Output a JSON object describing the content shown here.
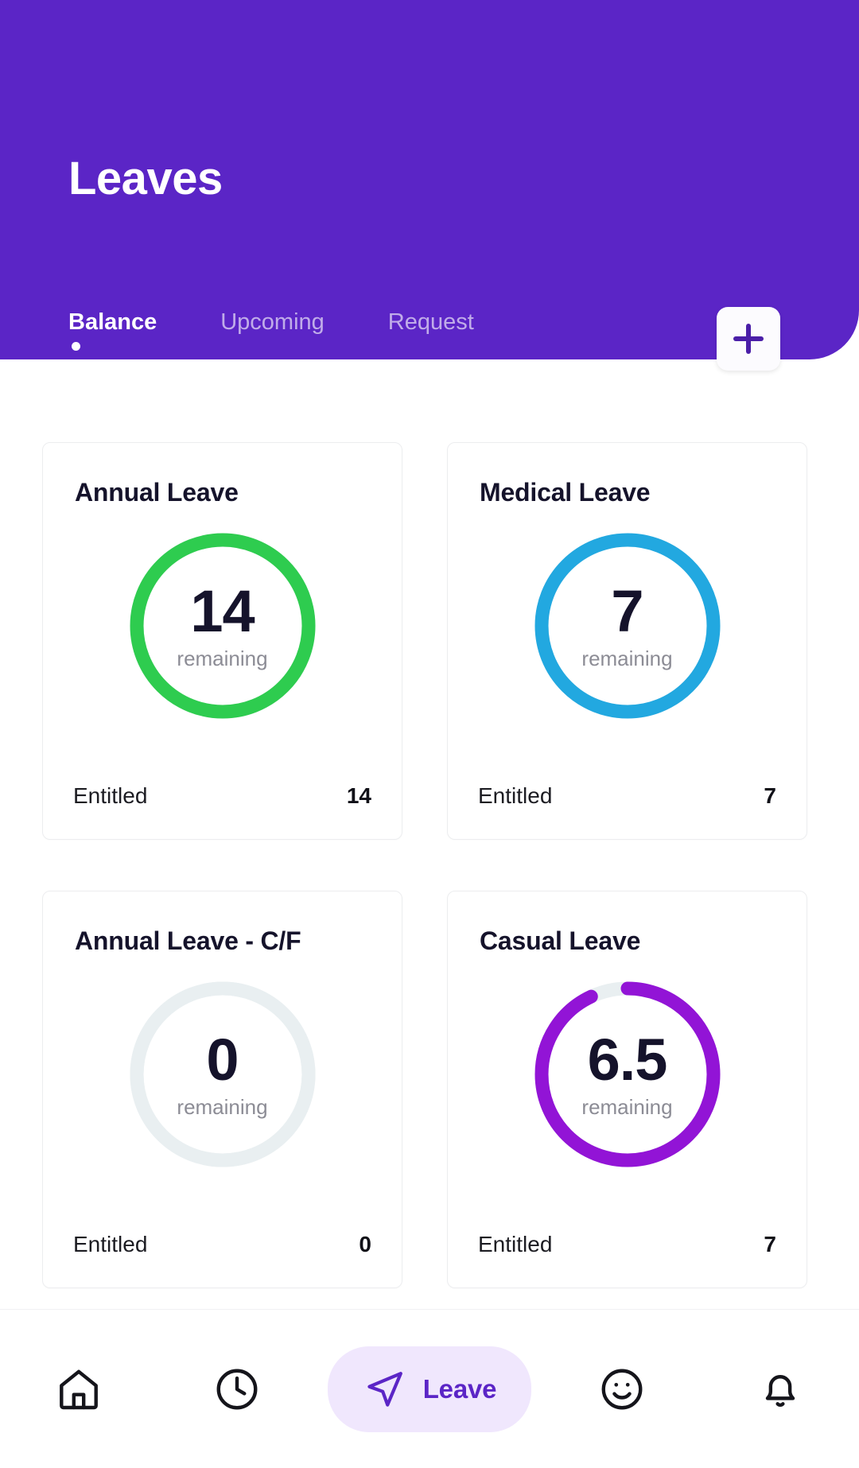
{
  "header": {
    "title": "Leaves",
    "background_color": "#5B25C6",
    "tabs": [
      {
        "label": "Balance",
        "active": true
      },
      {
        "label": "Upcoming",
        "active": false
      },
      {
        "label": "Request",
        "active": false
      }
    ],
    "add_button": {
      "icon": "plus-icon",
      "label": "+"
    }
  },
  "balance_cards": [
    {
      "title": "Annual Leave",
      "remaining": "14",
      "remaining_label": "remaining",
      "entitled_label": "Entitled",
      "entitled_value": "14",
      "ring_color": "#2ECC4F",
      "ring_track_color": "#E9EFF1",
      "ring_percent": 100
    },
    {
      "title": "Medical Leave",
      "remaining": "7",
      "remaining_label": "remaining",
      "entitled_label": "Entitled",
      "entitled_value": "7",
      "ring_color": "#22A8E0",
      "ring_track_color": "#E9EFF1",
      "ring_percent": 100
    },
    {
      "title": "Annual Leave - C/F",
      "remaining": "0",
      "remaining_label": "remaining",
      "entitled_label": "Entitled",
      "entitled_value": "0",
      "ring_color": "#E9EFF1",
      "ring_track_color": "#E9EFF1",
      "ring_percent": 0
    },
    {
      "title": "Casual Leave",
      "remaining": "6.5",
      "remaining_label": "remaining",
      "entitled_label": "Entitled",
      "entitled_value": "7",
      "ring_color": "#9214D6",
      "ring_track_color": "#E9EFF1",
      "ring_percent": 93
    }
  ],
  "bottom_nav": {
    "active_accent": "#5B25C6",
    "active_pill_background": "#F0E7FD",
    "items": [
      {
        "icon": "home-icon",
        "label": "",
        "active": false
      },
      {
        "icon": "clock-icon",
        "label": "",
        "active": false
      },
      {
        "icon": "navigation-arrow-icon",
        "label": "Leave",
        "active": true
      },
      {
        "icon": "smiley-face-icon",
        "label": "",
        "active": false
      },
      {
        "icon": "bell-icon",
        "label": "",
        "active": false
      }
    ]
  }
}
